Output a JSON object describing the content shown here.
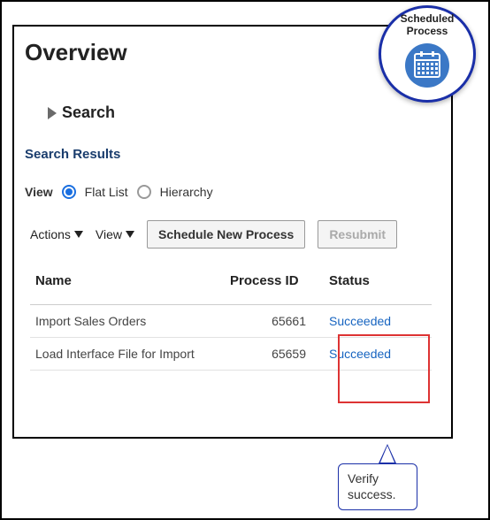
{
  "badge": {
    "line1": "Scheduled",
    "line2": "Process"
  },
  "page_title": "Overview",
  "search": {
    "label": "Search"
  },
  "results_heading": "Search Results",
  "view": {
    "label": "View",
    "option_flat": "Flat List",
    "option_hierarchy": "Hierarchy",
    "selected": "flat"
  },
  "toolbar": {
    "actions_label": "Actions",
    "view_label": "View",
    "schedule_label": "Schedule New Process",
    "resubmit_label": "Resubmit"
  },
  "table": {
    "columns": {
      "name": "Name",
      "process_id": "Process ID",
      "status": "Status"
    },
    "rows": [
      {
        "name": "Import Sales Orders",
        "process_id": "65661",
        "status": "Succeeded"
      },
      {
        "name": "Load Interface File for Import",
        "process_id": "65659",
        "status": "Succeeded"
      }
    ]
  },
  "callout": {
    "text": "Verify success."
  },
  "colors": {
    "accent": "#1a6fe0",
    "link": "#1764c0",
    "badge_border": "#1a2fa8",
    "highlight_box": "#d33"
  }
}
